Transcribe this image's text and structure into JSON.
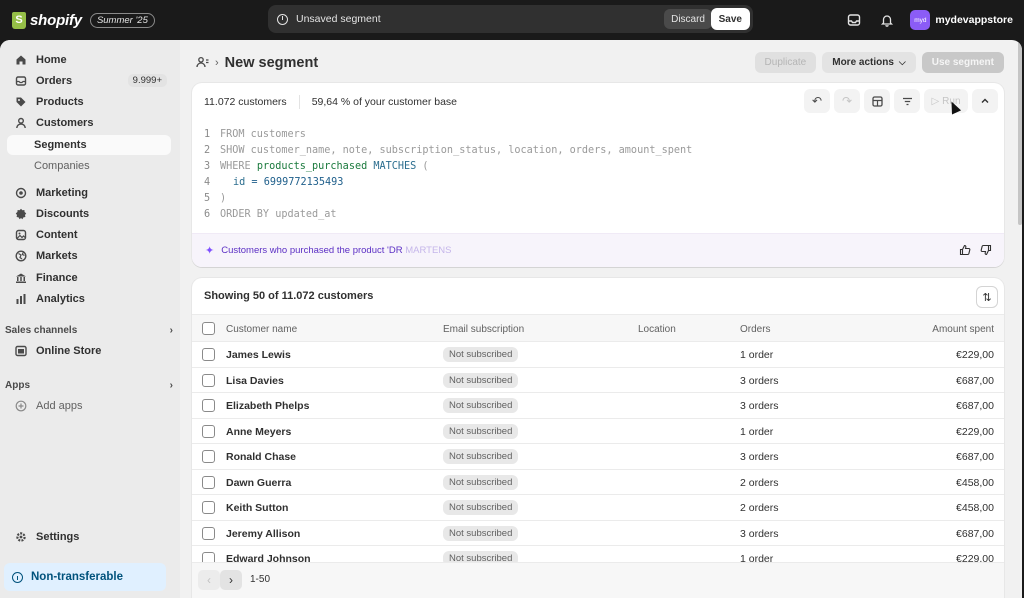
{
  "topbar": {
    "brand": "shopify",
    "edition_badge": "Summer '25",
    "unsaved_text": "Unsaved segment",
    "discard_label": "Discard",
    "save_label": "Save",
    "avatar_initials": "myd",
    "store_name": "mydevappstore",
    "icons": [
      "inbox-icon",
      "bell-icon"
    ]
  },
  "sidebar": {
    "items": [
      {
        "label": "Home",
        "icon": "home-icon"
      },
      {
        "label": "Orders",
        "icon": "orders-icon",
        "badge": "9.999+"
      },
      {
        "label": "Products",
        "icon": "tag-icon"
      },
      {
        "label": "Customers",
        "icon": "person-icon"
      },
      {
        "label": "Segments"
      },
      {
        "label": "Companies"
      },
      {
        "label": "Marketing",
        "icon": "target-icon"
      },
      {
        "label": "Discounts",
        "icon": "discount-icon"
      },
      {
        "label": "Content",
        "icon": "content-icon"
      },
      {
        "label": "Markets",
        "icon": "globe-icon"
      },
      {
        "label": "Finance",
        "icon": "bank-icon"
      },
      {
        "label": "Analytics",
        "icon": "chart-icon"
      }
    ],
    "sales_channels_label": "Sales channels",
    "online_store_label": "Online Store",
    "apps_label": "Apps",
    "add_apps_label": "Add apps",
    "settings_label": "Settings",
    "non_transferable_label": "Non-transferable"
  },
  "page": {
    "title": "New segment",
    "duplicate_label": "Duplicate",
    "more_actions_label": "More actions",
    "use_segment_label": "Use segment"
  },
  "editor": {
    "customer_count": "11.072 customers",
    "customer_base": "59,64 % of your customer base",
    "run_label": "Run",
    "line_numbers": [
      "1",
      "2",
      "3",
      "4",
      "5",
      "6"
    ],
    "line1": "FROM customers",
    "line2": "SHOW customer_name, note, subscription_status, location, orders, amount_spent",
    "line3_kw": "WHERE ",
    "line3_fn": "products_purchased",
    "line3_op": " MATCHES ",
    "line3_paren": "(",
    "line4_id": "id",
    "line4_eq": " = ",
    "line4_num": "6999772135493",
    "line5": ")",
    "line6": "ORDER BY updated_at",
    "ai_text": "Customers who purchased the product 'DR",
    "ai_text_fade": " MARTENS"
  },
  "table": {
    "showing": "Showing 50 of 11.072 customers",
    "headers": {
      "name": "Customer name",
      "email": "Email subscription",
      "location": "Location",
      "orders": "Orders",
      "amount": "Amount spent"
    },
    "rows": [
      {
        "name": "James Lewis",
        "email": "Not subscribed",
        "orders": "1 order",
        "amount": "€229,00"
      },
      {
        "name": "Lisa Davies",
        "email": "Not subscribed",
        "orders": "3 orders",
        "amount": "€687,00"
      },
      {
        "name": "Elizabeth Phelps",
        "email": "Not subscribed",
        "orders": "3 orders",
        "amount": "€687,00"
      },
      {
        "name": "Anne Meyers",
        "email": "Not subscribed",
        "orders": "1 order",
        "amount": "€229,00"
      },
      {
        "name": "Ronald Chase",
        "email": "Not subscribed",
        "orders": "3 orders",
        "amount": "€687,00"
      },
      {
        "name": "Dawn Guerra",
        "email": "Not subscribed",
        "orders": "2 orders",
        "amount": "€458,00"
      },
      {
        "name": "Keith Sutton",
        "email": "Not subscribed",
        "orders": "2 orders",
        "amount": "€458,00"
      },
      {
        "name": "Jeremy Allison",
        "email": "Not subscribed",
        "orders": "3 orders",
        "amount": "€687,00"
      },
      {
        "name": "Edward Johnson",
        "email": "Not subscribed",
        "orders": "1 order",
        "amount": "€229,00"
      }
    ],
    "pagination": "1-50"
  },
  "colors": {
    "brand_green": "#95bf47",
    "ai_purple": "#5b2fc4",
    "info_blue": "#00527c"
  }
}
